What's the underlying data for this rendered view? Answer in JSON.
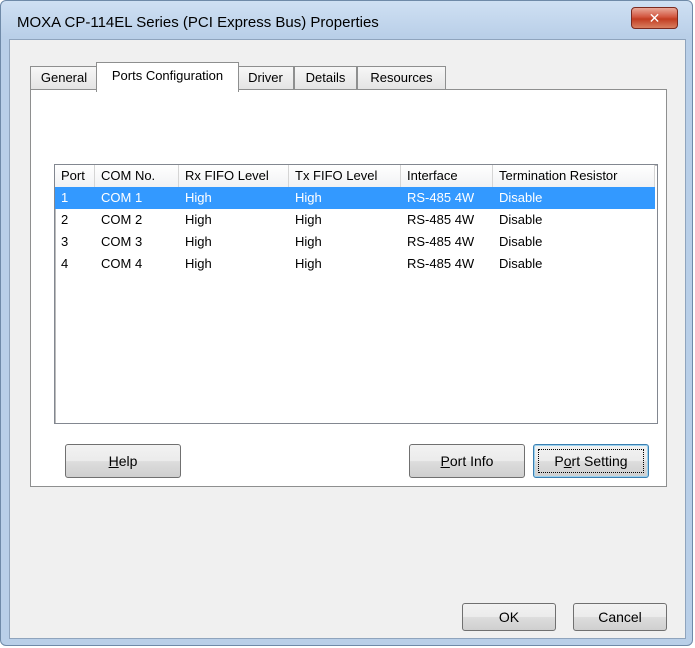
{
  "window": {
    "title": "MOXA CP-114EL Series (PCI Express Bus) Properties",
    "close_glyph": "✕"
  },
  "tabs": [
    {
      "label": "General"
    },
    {
      "label": "Ports Configuration"
    },
    {
      "label": "Driver"
    },
    {
      "label": "Details"
    },
    {
      "label": "Resources"
    }
  ],
  "table": {
    "columns": [
      "Port",
      "COM No.",
      "Rx FIFO Level",
      "Tx FIFO Level",
      "Interface",
      "Termination Resistor"
    ],
    "rows": [
      [
        "1",
        "COM 1",
        "High",
        "High",
        "RS-485 4W",
        "Disable"
      ],
      [
        "2",
        "COM 2",
        "High",
        "High",
        "RS-485 4W",
        "Disable"
      ],
      [
        "3",
        "COM 3",
        "High",
        "High",
        "RS-485 4W",
        "Disable"
      ],
      [
        "4",
        "COM 4",
        "High",
        "High",
        "RS-485 4W",
        "Disable"
      ]
    ],
    "selected_row": 0
  },
  "buttons": {
    "help": {
      "accel": "H",
      "rest": "elp"
    },
    "port_info": {
      "accel": "P",
      "rest": "ort Info"
    },
    "port_setting": {
      "pre": "P",
      "accel": "o",
      "rest": "rt Setting"
    },
    "ok": "OK",
    "cancel": "Cancel"
  },
  "colors": {
    "selection": "#3399ff",
    "close_button": "#c23d22"
  }
}
